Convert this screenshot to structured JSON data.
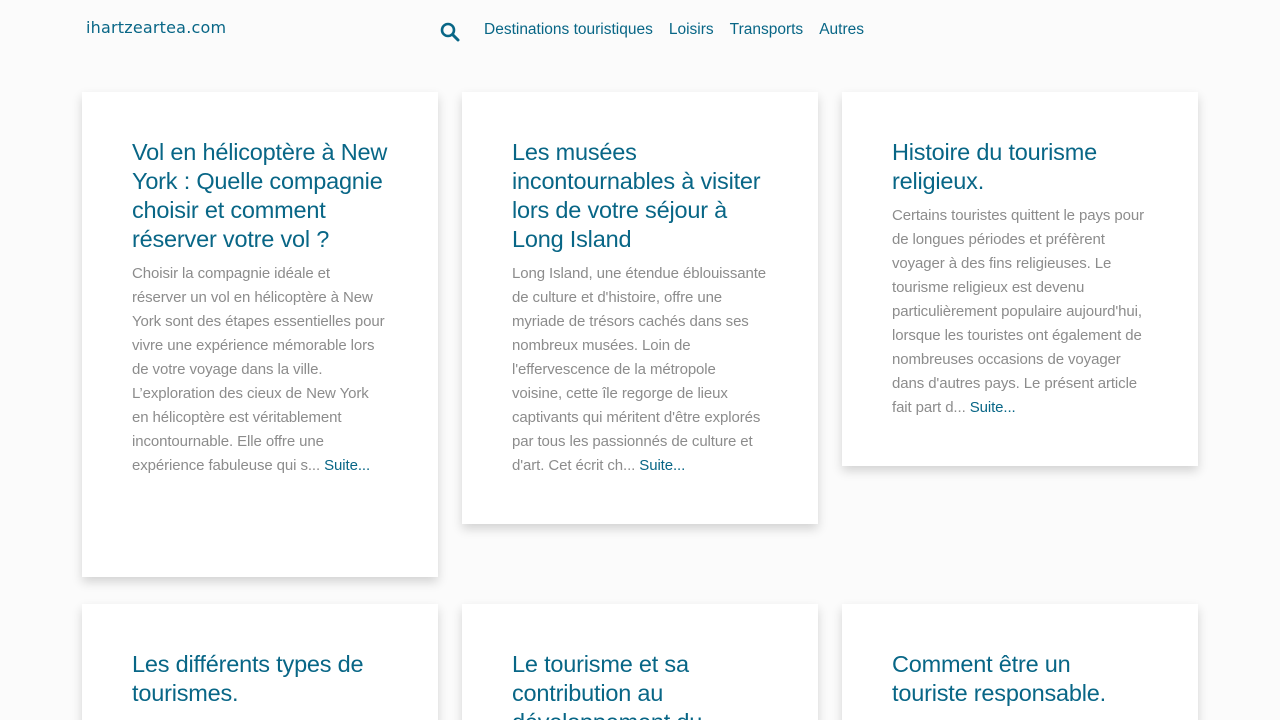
{
  "header": {
    "logo": "ihartzeartea.com",
    "nav": [
      {
        "label": "Destinations touristiques"
      },
      {
        "label": "Loisirs"
      },
      {
        "label": "Transports"
      },
      {
        "label": "Autres"
      }
    ]
  },
  "articles": [
    {
      "title": "Vol en hélicoptère à New York : Quelle compagnie choisir et comment réserver votre vol ?",
      "excerpt": "Choisir la compagnie idéale et réserver un vol en hélicoptère à New York sont des étapes essentielles pour vivre une expérience mémorable lors de votre voyage dans la ville. L’exploration des cieux de New York en hélicoptère est véritablement incontournable. Elle offre une expérience fabuleuse qui s...",
      "more": "Suite..."
    },
    {
      "title": "Les musées incontournables à visiter lors de votre séjour à Long Island",
      "excerpt": "Long Island, une étendue éblouissante de culture et d'histoire, offre une myriade de trésors cachés dans ses nombreux musées. Loin de l'effervescence de la métropole voisine, cette île regorge de lieux captivants qui méritent d'être explorés par tous les passionnés de culture et d'art. Cet écrit ch...",
      "more": "Suite..."
    },
    {
      "title": "Histoire du tourisme religieux.",
      "excerpt": "Certains touristes quittent le pays pour de longues périodes et préfèrent voyager à des fins religieuses. Le tourisme religieux est devenu particulièrement populaire aujourd'hui, lorsque les touristes ont également de nombreuses occasions de voyager dans d'autres pays. Le présent article fait part d...",
      "more": "Suite..."
    },
    {
      "title": "Les différents types de tourismes.",
      "excerpt": "",
      "more": ""
    },
    {
      "title": "Le tourisme et sa contribution au développement du",
      "excerpt": "",
      "more": ""
    },
    {
      "title": "Comment être un touriste responsable.",
      "excerpt": "",
      "more": ""
    }
  ]
}
